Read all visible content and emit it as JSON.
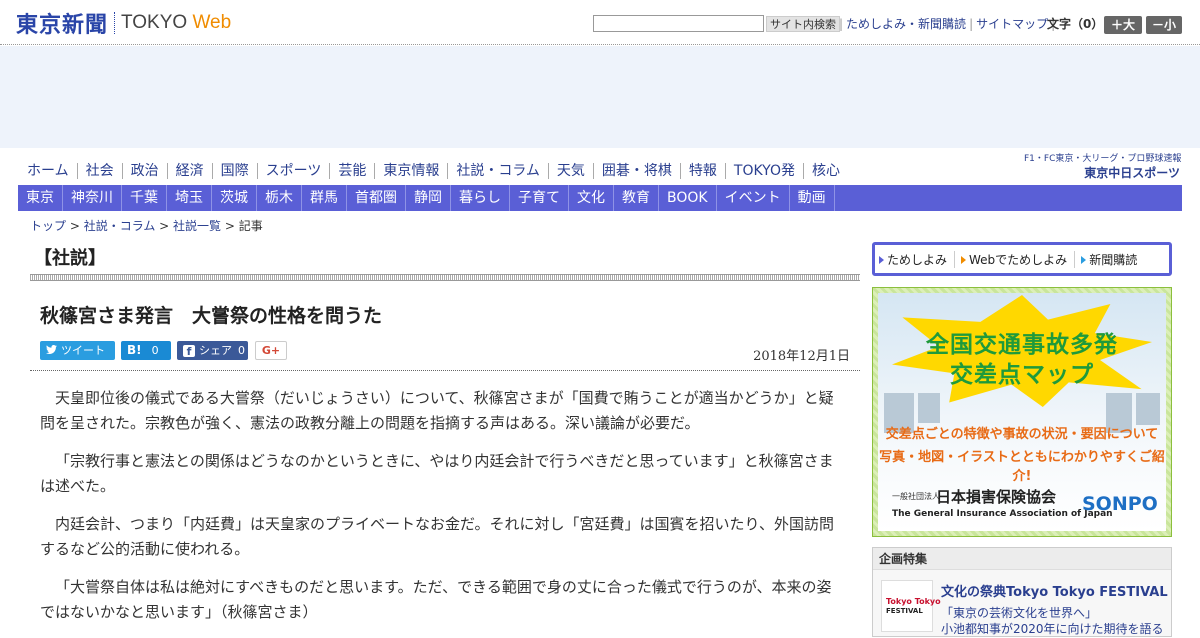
{
  "header": {
    "logo_jp": "東京新聞",
    "logo_en_prefix": "TOKYO ",
    "logo_en_web": "Web",
    "search_placeholder": "",
    "search_button": "サイト内検索",
    "links": [
      "ためしよみ・新聞購読",
      "サイトマップ"
    ],
    "font_size_label": "文字（0）",
    "font_larger": "＋大",
    "font_smaller": "－小"
  },
  "nav_main": [
    "ホーム",
    "社会",
    "政治",
    "経済",
    "国際",
    "スポーツ",
    "芸能",
    "東京情報",
    "社説・コラム",
    "天気",
    "囲碁・将棋",
    "特報",
    "TOKYO発",
    "核心"
  ],
  "partner": {
    "line1": "F1・FC東京・大リーグ・プロ野球速報",
    "line2": "東京中日スポーツ"
  },
  "nav_local": [
    "東京",
    "神奈川",
    "千葉",
    "埼玉",
    "茨城",
    "栃木",
    "群馬",
    "首都圏",
    "静岡",
    "暮らし",
    "子育て",
    "文化",
    "教育",
    "BOOK",
    "イベント",
    "動画"
  ],
  "breadcrumb": {
    "items": [
      "トップ",
      "社説・コラム",
      "社説一覧"
    ],
    "current": "記事",
    "sep": " > "
  },
  "article": {
    "section": "【社説】",
    "title": "秋篠宮さま発言　大嘗祭の性格を問うた",
    "date": "2018年12月1日",
    "share": {
      "tweet_label": "ツイート",
      "hatena_label": "B!",
      "hatena_count": "0",
      "facebook_label": "シェア",
      "facebook_count": "0",
      "gplus_label": "G+"
    },
    "paragraphs": [
      "天皇即位後の儀式である大嘗祭（だいじょうさい）について、秋篠宮さまが「国費で賄うことが適当かどうか」と疑問を呈された。宗教色が強く、憲法の政教分離上の問題を指摘する声はある。深い議論が必要だ。",
      "「宗教行事と憲法との関係はどうなのかというときに、やはり内廷会計で行うべきだと思っています」と秋篠宮さまは述べた。",
      "内廷会計、つまり「内廷費」は天皇家のプライベートなお金だ。それに対し「宮廷費」は国賓を招いたり、外国訪問するなど公的活動に使われる。",
      "「大嘗祭自体は私は絶対にすべきものだと思います。ただ、できる範囲で身の丈に合った儀式で行うのが、本来の姿ではないかなと思います」（秋篠宮さま）"
    ]
  },
  "sidebar": {
    "subscribe": [
      "ためしよみ",
      "Webでためしよみ",
      "新聞購読"
    ],
    "ad": {
      "title1": "全国交通事故多発",
      "title2": "交差点マップ",
      "desc1": "交差点ごとの特徴や事故の状況・要因について",
      "desc2": "写真・地図・イラストとともにわかりやすくご紹介!",
      "org_prefix": "一般社団法人",
      "org": "日本損害保険協会",
      "org_en": "The General Insurance Association of Japan",
      "brand": "SONPO"
    },
    "feature": {
      "heading": "企画特集",
      "thumb1": "Tokyo Tokyo",
      "thumb2": "FESTIVAL",
      "title": "文化の祭典Tokyo Tokyo FESTIVAL",
      "sub1": "「東京の芸術文化を世界へ」",
      "sub2": "小池都知事が2020年に向けた期待を語る"
    }
  }
}
